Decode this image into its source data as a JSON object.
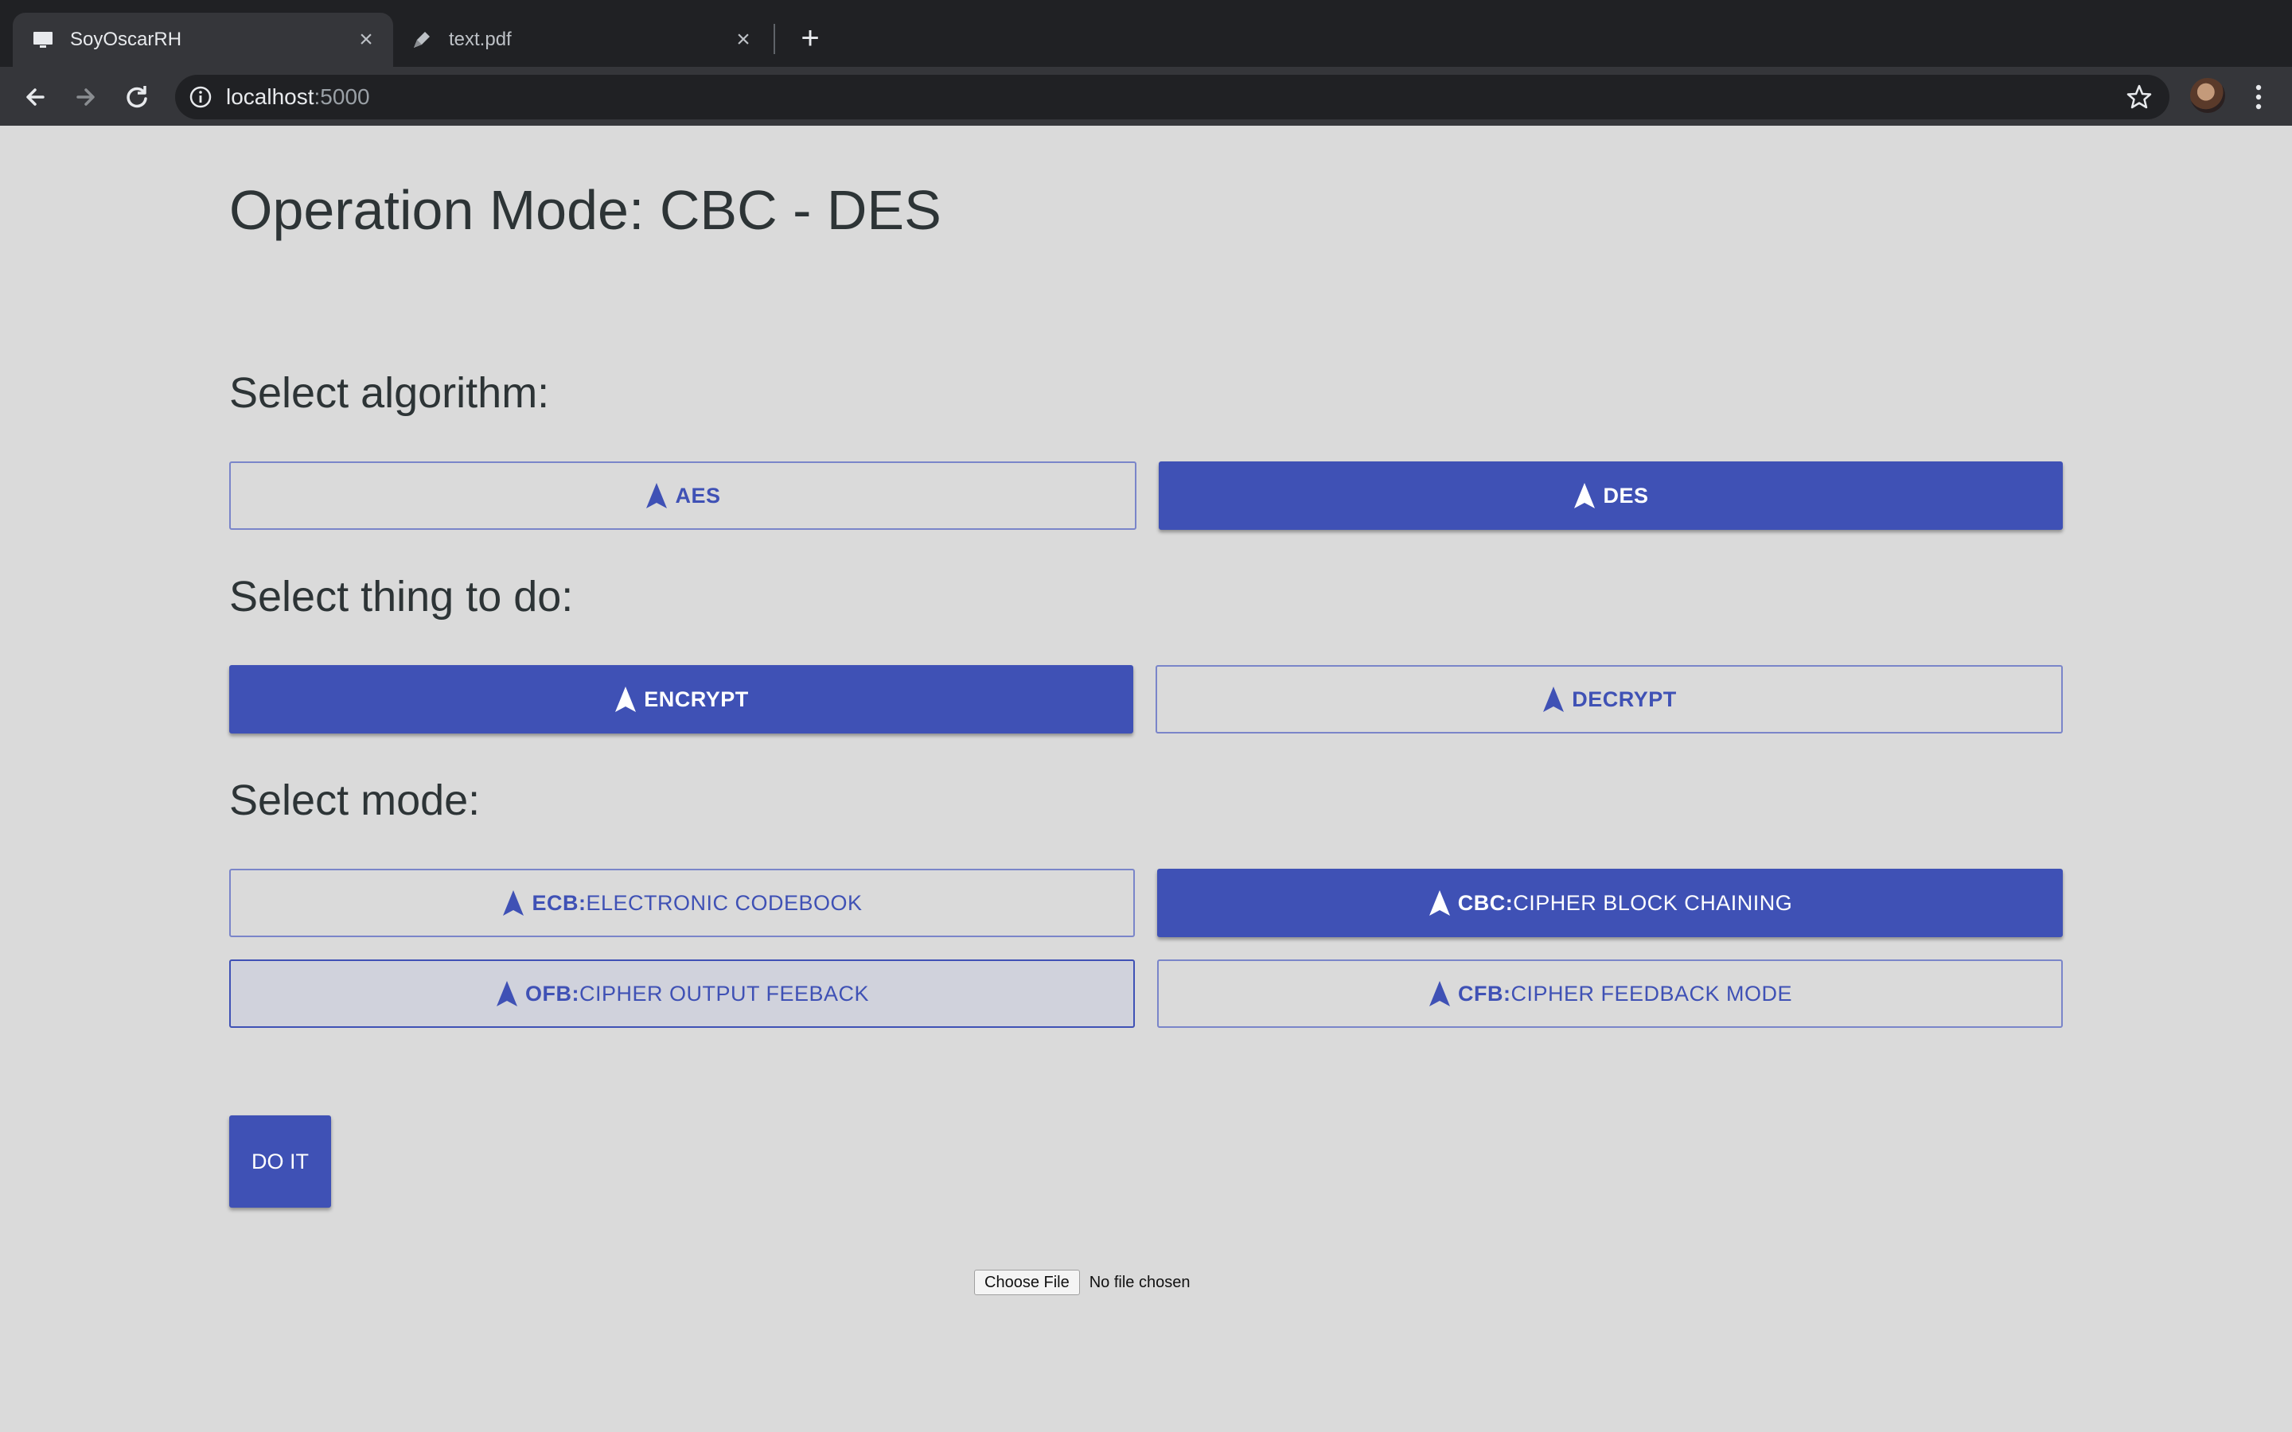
{
  "browser": {
    "tabs": [
      {
        "title": "SoyOscarRH",
        "active": true
      },
      {
        "title": "text.pdf",
        "active": false
      }
    ],
    "url_host": "localhost",
    "url_port": ":5000"
  },
  "page": {
    "title": "Operation Mode: CBC - DES",
    "algorithm_heading": "Select algorithm:",
    "algorithms": [
      {
        "label": "AES",
        "selected": false
      },
      {
        "label": "DES",
        "selected": true
      }
    ],
    "action_heading": "Select thing to do:",
    "actions": [
      {
        "label": "ENCRYPT",
        "selected": true
      },
      {
        "label": "DECRYPT",
        "selected": false
      }
    ],
    "mode_heading": "Select mode:",
    "modes": [
      {
        "code": "ECB:",
        "name": "ELECTRONIC CODEBOOK",
        "selected": false
      },
      {
        "code": "CBC:",
        "name": "CIPHER BLOCK CHAINING",
        "selected": true
      },
      {
        "code": "OFB:",
        "name": "CIPHER OUTPUT FEEBACK",
        "selected": false,
        "hovered": true
      },
      {
        "code": "CFB:",
        "name": "CIPHER FEEDBACK MODE",
        "selected": false
      }
    ],
    "submit_label": "DO IT",
    "file_button_label": "Choose File",
    "file_status": "No file chosen"
  },
  "colors": {
    "primary": "#3f51b5",
    "page_background": "#dadada",
    "heading_text": "#2d3436"
  }
}
